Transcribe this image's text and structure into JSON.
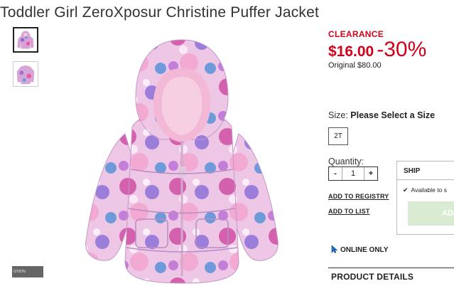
{
  "product": {
    "title": "Toddler Girl ZeroXposur Christine Puffer Jacket",
    "image_icon": "puffer-jacket-image",
    "thumbnails": [
      {
        "icon": "jacket-thumbnail",
        "selected": true
      },
      {
        "icon": "jacket-thumbnail",
        "selected": false
      }
    ],
    "zoom_overlay_label": "отать"
  },
  "pricing": {
    "badge": "CLEARANCE",
    "sale_price": "$16.00",
    "discount": "-30%",
    "original_price": "Original $80.00",
    "accent_color": "#d0021b"
  },
  "size": {
    "label": "Size:",
    "prompt": "Please Select a Size",
    "options": [
      "2T"
    ]
  },
  "quantity": {
    "label": "Quantity:",
    "minus": "-",
    "value": "1",
    "plus": "+"
  },
  "links": {
    "registry": "ADD TO REGISTRY",
    "list": "ADD TO LIST"
  },
  "shipping": {
    "tab": "SHIP",
    "availability": "Available to s",
    "add_button": "ADD",
    "add_button_color": "#d9ecd3"
  },
  "online_only": "ONLINE ONLY",
  "details_heading": "PRODUCT DETAILS"
}
